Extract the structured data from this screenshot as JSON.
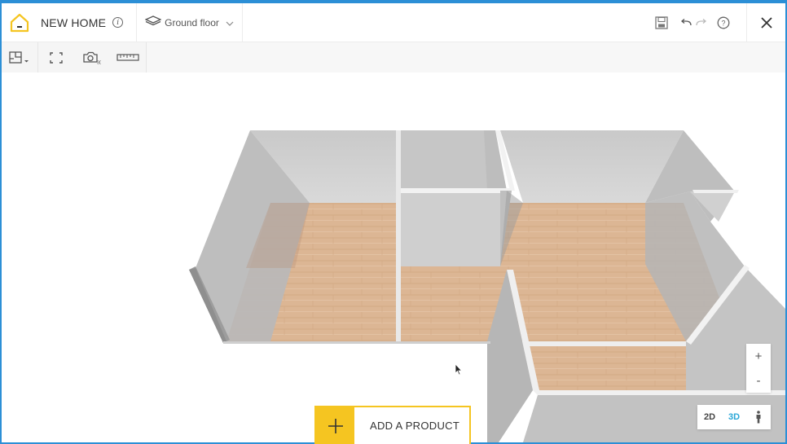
{
  "header": {
    "project_title": "NEW HOME",
    "floor_label": "Ground floor",
    "icons": {
      "logo": "house-logo-icon",
      "info": "info-icon",
      "floor": "layers-icon",
      "dropdown": "chevron-down-icon",
      "save": "save-icon",
      "undo": "undo-icon",
      "redo": "redo-icon",
      "help": "help-icon",
      "close": "close-icon"
    }
  },
  "toolbar": {
    "tools": [
      "floor-plan-icon",
      "fullscreen-icon",
      "camera-3d-icon",
      "ruler-icon"
    ]
  },
  "zoom": {
    "in_label": "+",
    "out_label": "-"
  },
  "view_toggle": {
    "label_2d": "2D",
    "label_3d": "3D",
    "active": "3D",
    "person_icon": "person-view-icon"
  },
  "add_product": {
    "label": "ADD A PRODUCT"
  },
  "colors": {
    "accent": "#f5c521",
    "active_view": "#2aa7d7",
    "frame": "#2c8fd6"
  }
}
